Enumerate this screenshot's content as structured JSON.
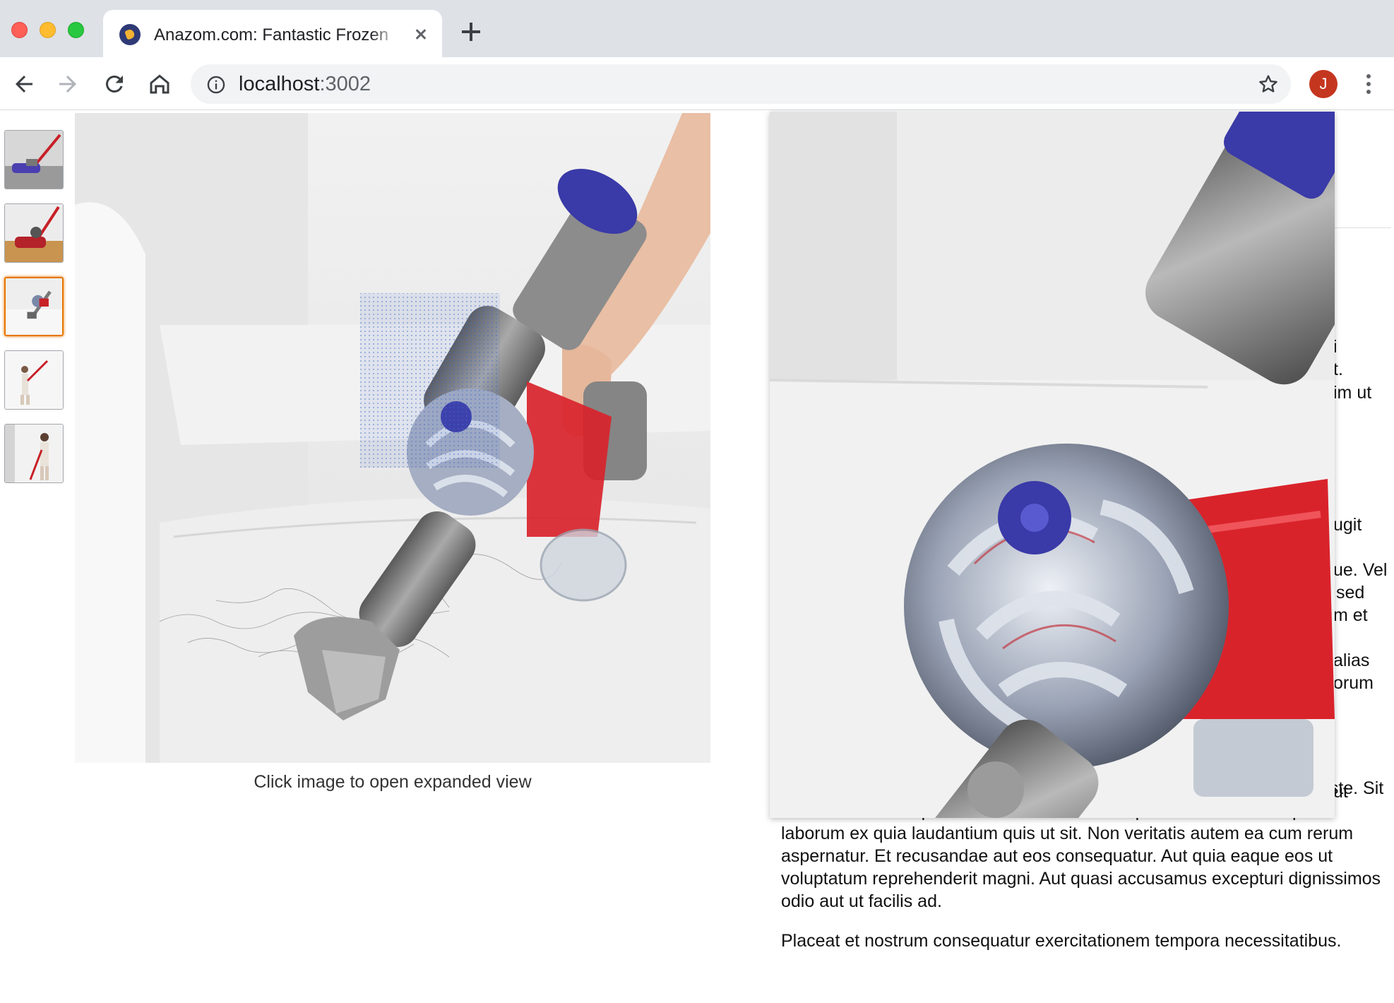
{
  "browser": {
    "tab_title": "Anazom.com: Fantastic Frozen",
    "url_host": "localhost",
    "url_port": ":3002",
    "profile_initial": "J"
  },
  "product": {
    "image_caption": "Click image to open expanded view",
    "description_paragraphs": [
      "ratione id cumque. Perferendis sit voluptates nam laudantium. Et non iste. Sit distinctio rerum reprehenderit est laborum culpa. Aut laboriosam quod laborum ex quia laudantium quis ut sit. Non veritatis autem ea cum rerum aspernatur. Et recusandae aut eos consequatur. Aut quia eaque eos ut voluptatum reprehenderit magni. Aut quasi accusamus excepturi dignissimos odio aut ut facilis ad.",
      "Placeat et nostrum consequatur exercitationem tempora necessitatibus."
    ],
    "partially_hidden_text": [
      "i",
      "t.",
      "im ut",
      "ugit",
      "ue. Vel",
      "sed",
      "m et",
      "alias",
      "orum",
      "ut"
    ]
  },
  "colors": {
    "accent_orange": "#e77600",
    "profile_red": "#c5361f",
    "vacuum_red": "#d9232b",
    "vacuum_purple": "#3a3aa8"
  },
  "icons": [
    "back-arrow-icon",
    "forward-arrow-icon",
    "reload-icon",
    "home-icon",
    "info-icon",
    "star-icon",
    "menu-dots-icon",
    "close-icon",
    "plus-icon"
  ]
}
